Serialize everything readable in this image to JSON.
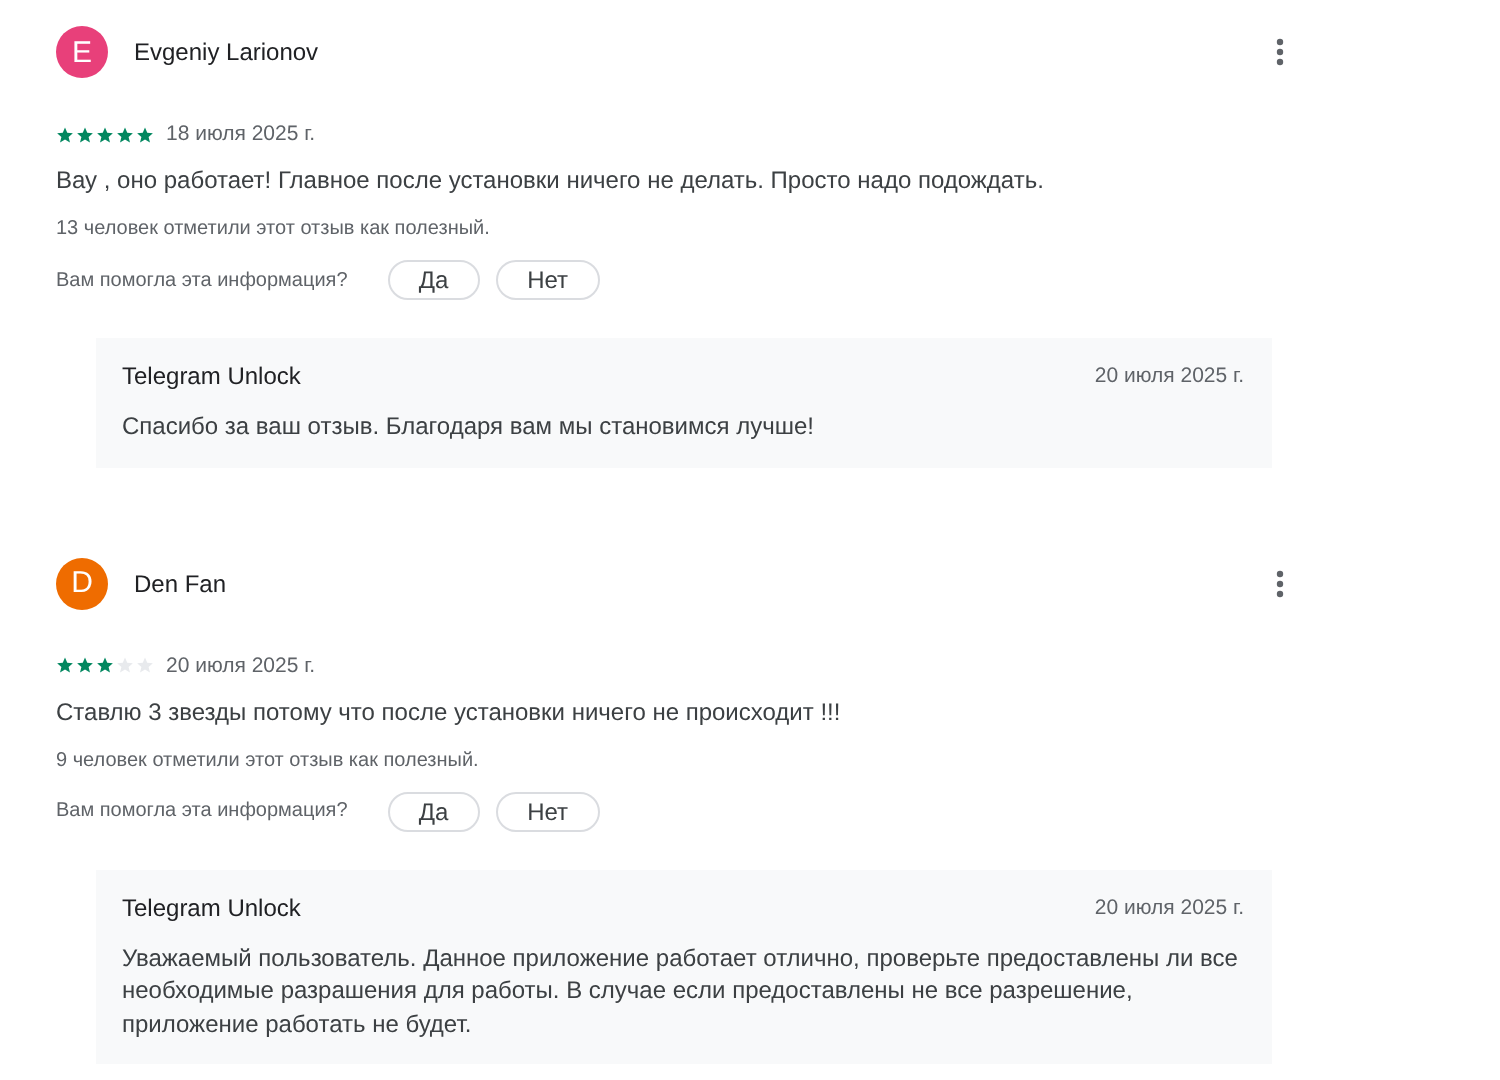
{
  "reviews": [
    {
      "avatar_letter": "E",
      "color": "#e8407a",
      "author": "Evgeniy Larionov",
      "stars": 5,
      "date": "18 июля 2025 г.",
      "text": "Вау , оно работает! Главное после установки ничего не делать. Просто надо подождать.",
      "helpful": "13 человек отметили этот отзыв как полезный.",
      "question": "Вам помогла эта информация?",
      "buttons": [
        "Да",
        "Нет"
      ],
      "reply": {
        "author": "Telegram Unlock",
        "date": "20 июля 2025 г.",
        "text": "Спасибо за ваш отзыв. Благодаря вам мы становимся лучше!"
      }
    },
    {
      "avatar_letter": "D",
      "color": "#ef6c00",
      "author": "Den Fan",
      "stars": 3,
      "date": "20 июля 2025 г.",
      "text": "Ставлю 3 звезды потому что после установки ничего не происходит !!!",
      "helpful": "9 человек отметили этот отзыв как полезный.",
      "question": "Вам помогла эта информация?",
      "buttons": [
        "Да",
        "Нет"
      ],
      "reply": {
        "author": "Telegram Unlock",
        "date": "20 июля 2025 г.",
        "text": "Уважаемый пользователь. Данное приложение работает отлично, проверьте предоставлены ли все необходимые разрашения для работы. В случае если предоставлены не все разрешение, приложение работать не будет."
      }
    }
  ]
}
